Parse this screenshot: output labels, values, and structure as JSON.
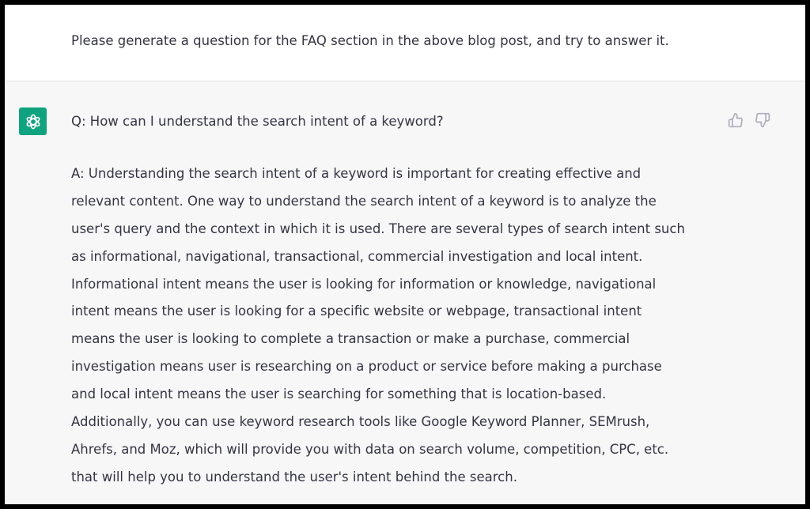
{
  "conversation": {
    "user_message": "Please generate a question for the FAQ section in the above blog post, and try to answer it.",
    "assistant": {
      "question": "Q: How can I understand the search intent of a keyword?",
      "answer_lines": [
        "A: Understanding the search intent of a keyword is important for creating effective and",
        "relevant content. One way to understand the search intent of a keyword is to analyze the",
        "user's query and the context in which it is used. There are several types of search intent such",
        "as informational, navigational, transactional, commercial investigation and local intent.",
        "Informational intent means the user is looking for information or knowledge, navigational",
        "intent means the user is looking for a specific website or webpage, transactional intent",
        "means the user is looking to complete a transaction or make a purchase, commercial",
        "investigation means user is researching on a product or service before making a purchase",
        "and local intent means the user is searching for something that is location-based.",
        "Additionally, you can use keyword research tools like Google Keyword Planner, SEMrush,",
        "Ahrefs, and Moz, which will provide you with data on search volume, competition, CPC, etc.",
        "that will help you to understand the user's intent behind the search."
      ]
    }
  },
  "icons": {
    "avatar": "openai-logo-icon",
    "feedback_up": "thumbs-up-icon",
    "feedback_down": "thumbs-down-icon"
  },
  "colors": {
    "avatar_bg": "#10a37f",
    "assistant_bg": "#f7f7f8",
    "text": "#343541",
    "icon": "#acacbe",
    "frame_border": "#000000"
  }
}
